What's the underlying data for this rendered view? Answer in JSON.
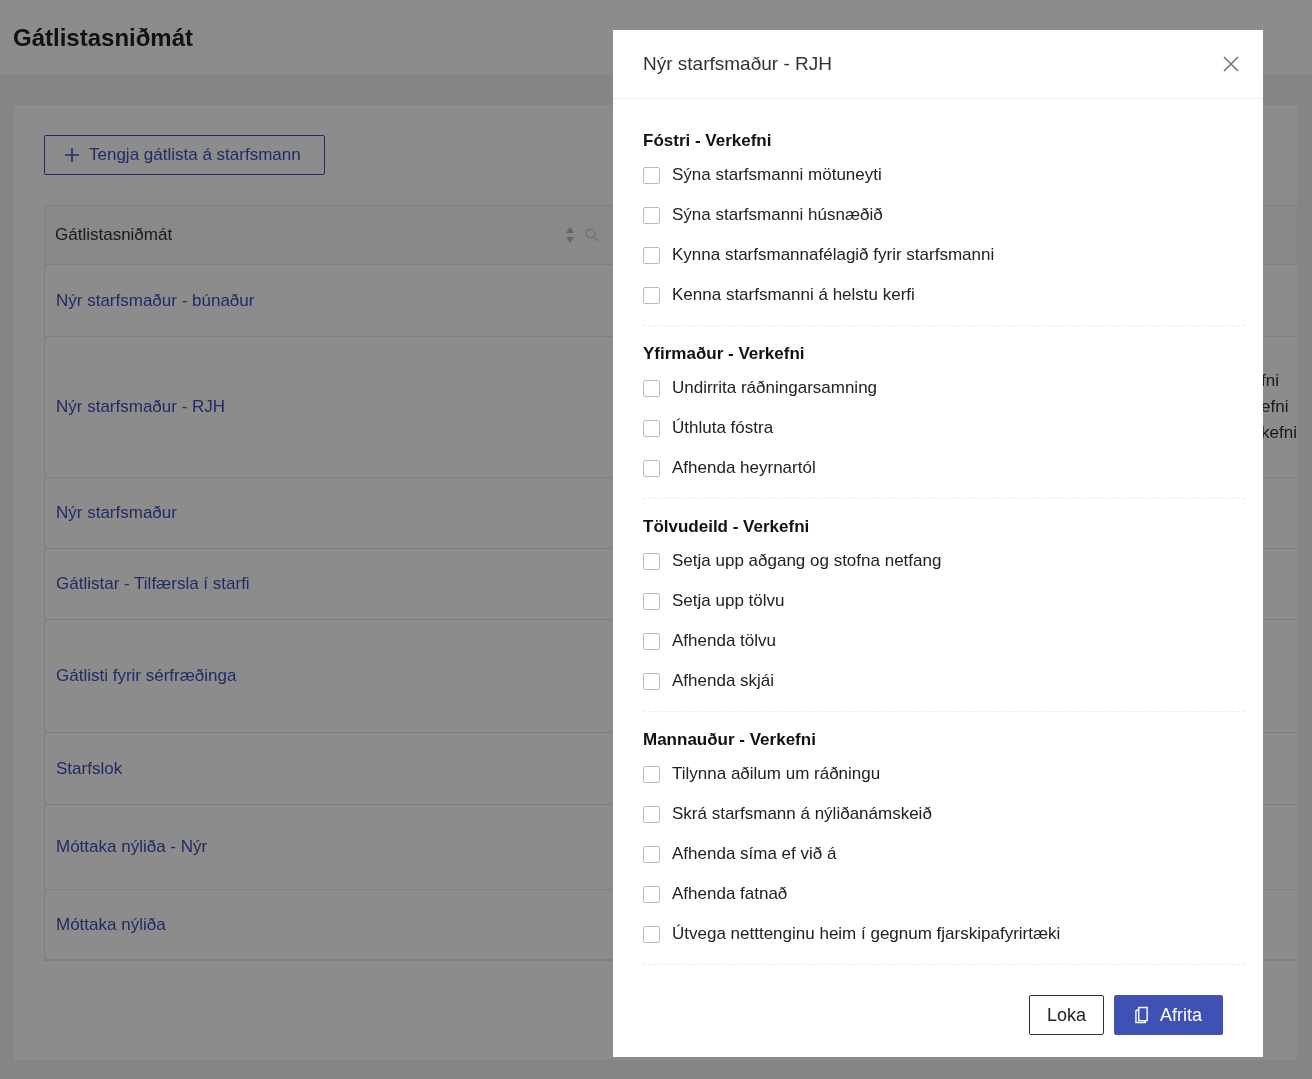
{
  "page": {
    "title": "Gátlistasniðmát",
    "add_button": "Tengja gátlista á starfsmann"
  },
  "table": {
    "columns": [
      {
        "label": "Gátlistasniðmát"
      }
    ],
    "rows": [
      {
        "name": "Nýr starfsmaður - búnaður"
      },
      {
        "name": "Nýr starfsmaður - RJH",
        "column_3": [
          "fni",
          "efni",
          "kefni"
        ]
      },
      {
        "name": "Nýr starfsmaður"
      },
      {
        "name": "Gátlistar - Tilfærsla í starfi"
      },
      {
        "name": "Gátlisti fyrir sérfræðinga"
      },
      {
        "name": "Starfslok"
      },
      {
        "name": "Móttaka nýliða - Nýr"
      },
      {
        "name": "Móttaka nýliða"
      }
    ]
  },
  "modal": {
    "title": "Nýr starfsmaður - RJH",
    "sections": [
      {
        "heading": "Fóstri - Verkefni",
        "items": [
          {
            "label": "Sýna starfsmanni mötuneyti",
            "checked": false
          },
          {
            "label": "Sýna starfsmanni húsnæðið",
            "checked": false
          },
          {
            "label": "Kynna starfsmannafélagið fyrir starfsmanni",
            "checked": false
          },
          {
            "label": "Kenna starfsmanni á helstu kerfi",
            "checked": false
          }
        ]
      },
      {
        "heading": "Yfirmaður - Verkefni",
        "items": [
          {
            "label": "Undirrita ráðningarsamning",
            "checked": false
          },
          {
            "label": "Úthluta fóstra",
            "checked": false
          },
          {
            "label": "Afhenda heyrnartól",
            "checked": false
          }
        ]
      },
      {
        "heading": "Tölvudeild - Verkefni",
        "items": [
          {
            "label": "Setja upp aðgang og stofna netfang",
            "checked": false
          },
          {
            "label": "Setja upp tölvu",
            "checked": false
          },
          {
            "label": "Afhenda tölvu",
            "checked": false
          },
          {
            "label": "Afhenda skjái",
            "checked": false
          }
        ]
      },
      {
        "heading": "Mannauður - Verkefni",
        "items": [
          {
            "label": "Tilynna aðilum um ráðningu",
            "checked": false
          },
          {
            "label": "Skrá starfsmann á nýliðanámskeið",
            "checked": false
          },
          {
            "label": "Afhenda síma ef við á",
            "checked": false
          },
          {
            "label": "Afhenda fatnað",
            "checked": false
          },
          {
            "label": "Útvega netttenginu heim í gegnum fjarskipafyrirtæki",
            "checked": false
          }
        ]
      }
    ],
    "buttons": [
      {
        "label": "Loka",
        "kind": "secondary"
      },
      {
        "label": "Afrita",
        "kind": "primary"
      }
    ]
  }
}
